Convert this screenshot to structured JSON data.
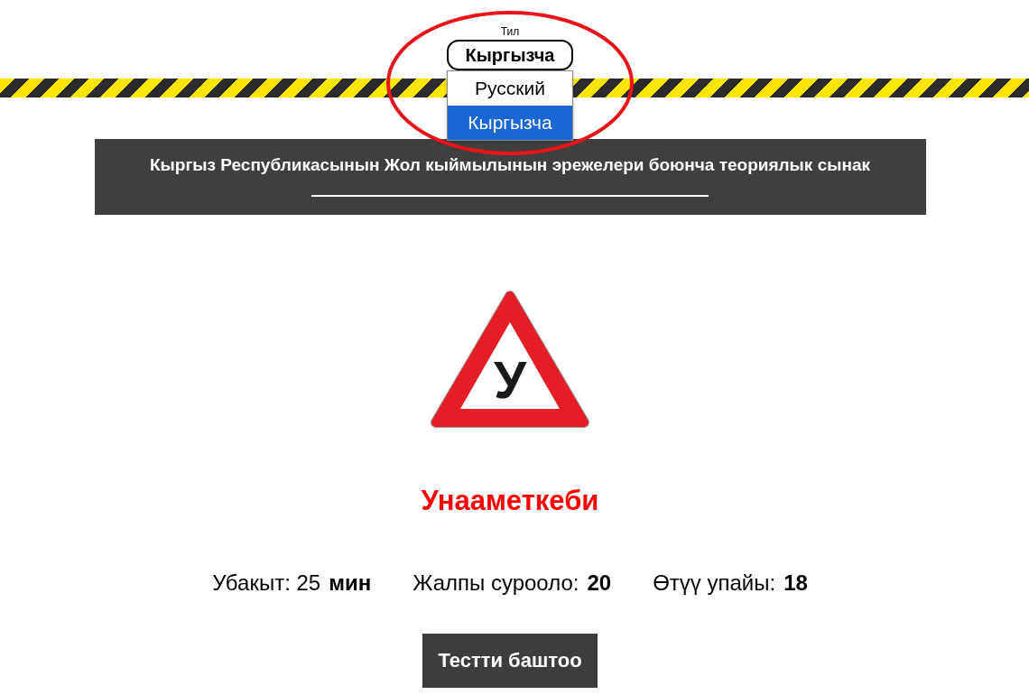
{
  "language": {
    "label": "Тил",
    "value": "Кыргызча",
    "expanded": true,
    "options": [
      {
        "label": "Русский",
        "selected": false
      },
      {
        "label": "Кыргызча",
        "selected": true
      }
    ]
  },
  "header": {
    "title": "Кыргыз Республикасынын Жол кыймылынын эрежелери боюнча теориялык сынак"
  },
  "category": {
    "sign_letter": "У",
    "title": "Унааметкеби"
  },
  "stats": [
    {
      "label": "Убакыт: 25",
      "value": "мин"
    },
    {
      "label": "Жалпы сурооло:",
      "value": "20"
    },
    {
      "label": "Өтүү упайы:",
      "value": "18"
    }
  ],
  "start_button": {
    "label": "Тестти баштоо"
  }
}
